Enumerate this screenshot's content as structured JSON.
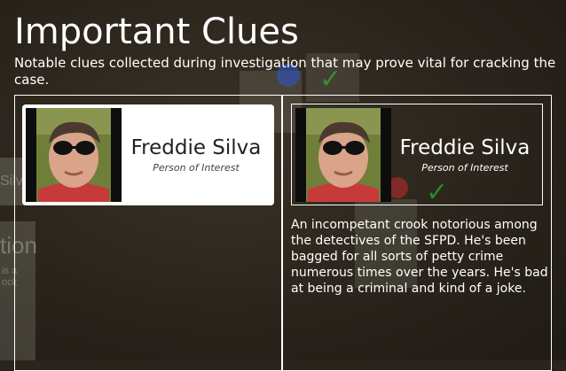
{
  "header": {
    "title": "Important Clues",
    "subtitle": "Notable clues collected during investigation that may prove vital for cracking the case."
  },
  "background": {
    "fragment_1": "Silv",
    "fragment_2": "tion",
    "fragment_3": "is a\nock"
  },
  "clues": [
    {
      "name": "Freddie Silva",
      "role": "Person of Interest",
      "style": "collapsed"
    },
    {
      "name": "Freddie Silva",
      "role": "Person of Interest",
      "style": "expanded",
      "description": "An incompetant crook notorious among the detectives of the SFPD. He's been bagged for all sorts of petty crime numerous times over the years. He's bad at being a criminal and kind of a joke."
    }
  ],
  "icons": {
    "portrait": "person-portrait-icon",
    "pin": "push-pin-icon",
    "check": "check-mark-icon"
  },
  "colors": {
    "overlay_bg": "#2a241c",
    "text": "#ffffff",
    "card_bg": "#ffffff",
    "card_text": "#222222"
  }
}
